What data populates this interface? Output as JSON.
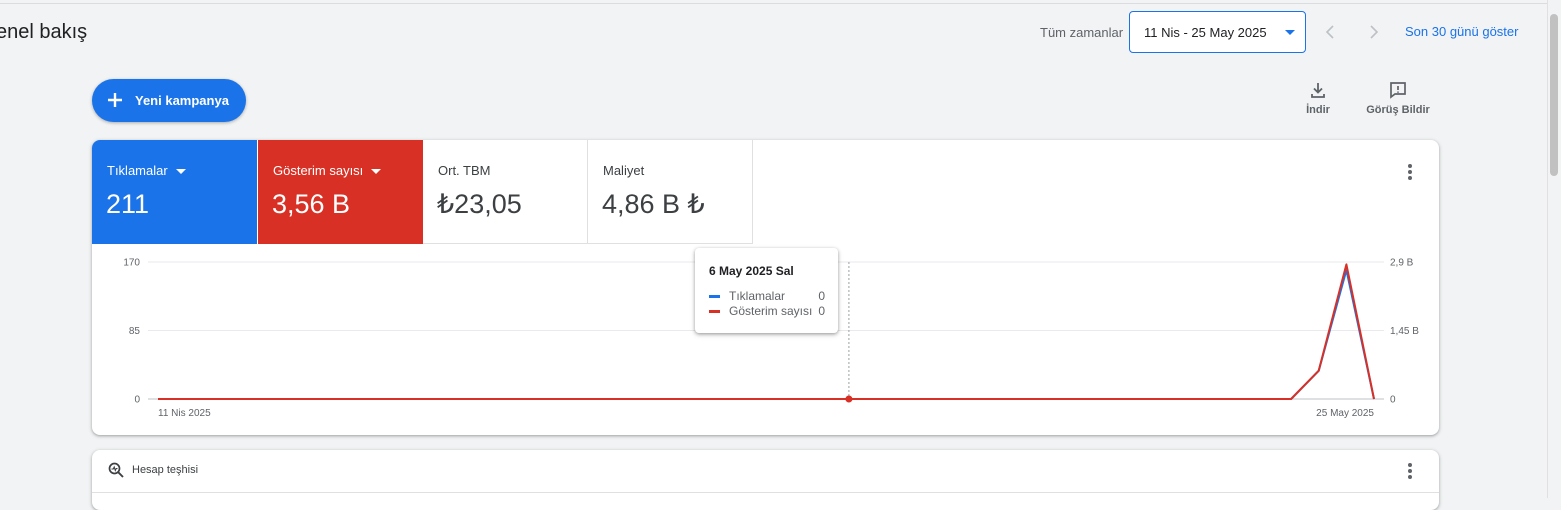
{
  "header": {
    "page_title": "enel bakış",
    "range_label": "Tüm zamanlar",
    "date_range": "11 Nis - 25 May 2025",
    "show_last_30": "Son 30 günü göster"
  },
  "toolbar": {
    "new_campaign": "Yeni kampanya",
    "download": "İndir",
    "feedback": "Görüş Bildir"
  },
  "metrics": [
    {
      "label": "Tıklamalar",
      "value": "211",
      "color": "#1a73e8"
    },
    {
      "label": "Gösterim sayısı",
      "value": "3,56 B",
      "color": "#d93025"
    },
    {
      "label": "Ort. TBM",
      "value": "₺23,05"
    },
    {
      "label": "Maliyet",
      "value": "4,86 B ₺"
    }
  ],
  "chart_data": {
    "type": "line",
    "x_start_label": "11 Nis 2025",
    "x_end_label": "25 May 2025",
    "days": 45,
    "left_axis_ticks": [
      "170",
      "85",
      "0"
    ],
    "right_axis_ticks": [
      "2,9 B",
      "1,45 B",
      "0"
    ],
    "left_max": 170,
    "right_max": 2900,
    "series": [
      {
        "name": "Tıklamalar",
        "color": "#1a73e8",
        "axis": "left",
        "points": [
          [
            0,
            0
          ],
          [
            41,
            0
          ],
          [
            42,
            35
          ],
          [
            43,
            160
          ],
          [
            44,
            0
          ]
        ]
      },
      {
        "name": "Gösterim sayısı",
        "color": "#d93025",
        "axis": "right",
        "points": [
          [
            0,
            0
          ],
          [
            41,
            0
          ],
          [
            42,
            600
          ],
          [
            43,
            2850
          ],
          [
            44,
            0
          ]
        ]
      }
    ],
    "hover_index": 25
  },
  "tooltip": {
    "title": "6 May 2025 Sal",
    "rows": [
      {
        "name": "Tıklamalar",
        "value": "0",
        "color": "#1a73e8"
      },
      {
        "name": "Gösterim sayısı",
        "value": "0",
        "color": "#d93025"
      }
    ]
  },
  "diagnostics": {
    "title": "Hesap teşhisi"
  }
}
